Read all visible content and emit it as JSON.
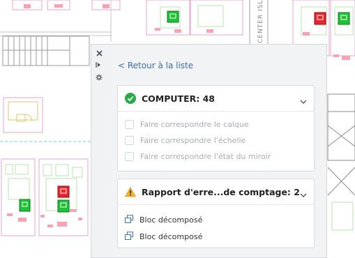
{
  "background": {
    "street_label": "CENTER ISLAND"
  },
  "strip": {
    "close_icon": "close-icon",
    "collapse_icon": "collapse-arrows-icon",
    "settings_icon": "gear-icon"
  },
  "panel": {
    "back_link": "< Retour à la liste",
    "computer_card": {
      "icon": "success-check-icon",
      "title": "COMPUTER: 48",
      "options": [
        "Faire correspondre le calque",
        "Faire correspondre l'échelle",
        "Faire correspondre l'état du miroir"
      ]
    },
    "error_card": {
      "icon": "warning-icon",
      "title": "Rapport d'erre...de comptage: 2",
      "items": [
        "Bloc décomposé",
        "Bloc décomposé"
      ]
    }
  },
  "colors": {
    "success": "#2aa84a",
    "warning": "#f3b42a",
    "link": "#3a6ea5",
    "panel_bg": "#f2f3f5"
  }
}
